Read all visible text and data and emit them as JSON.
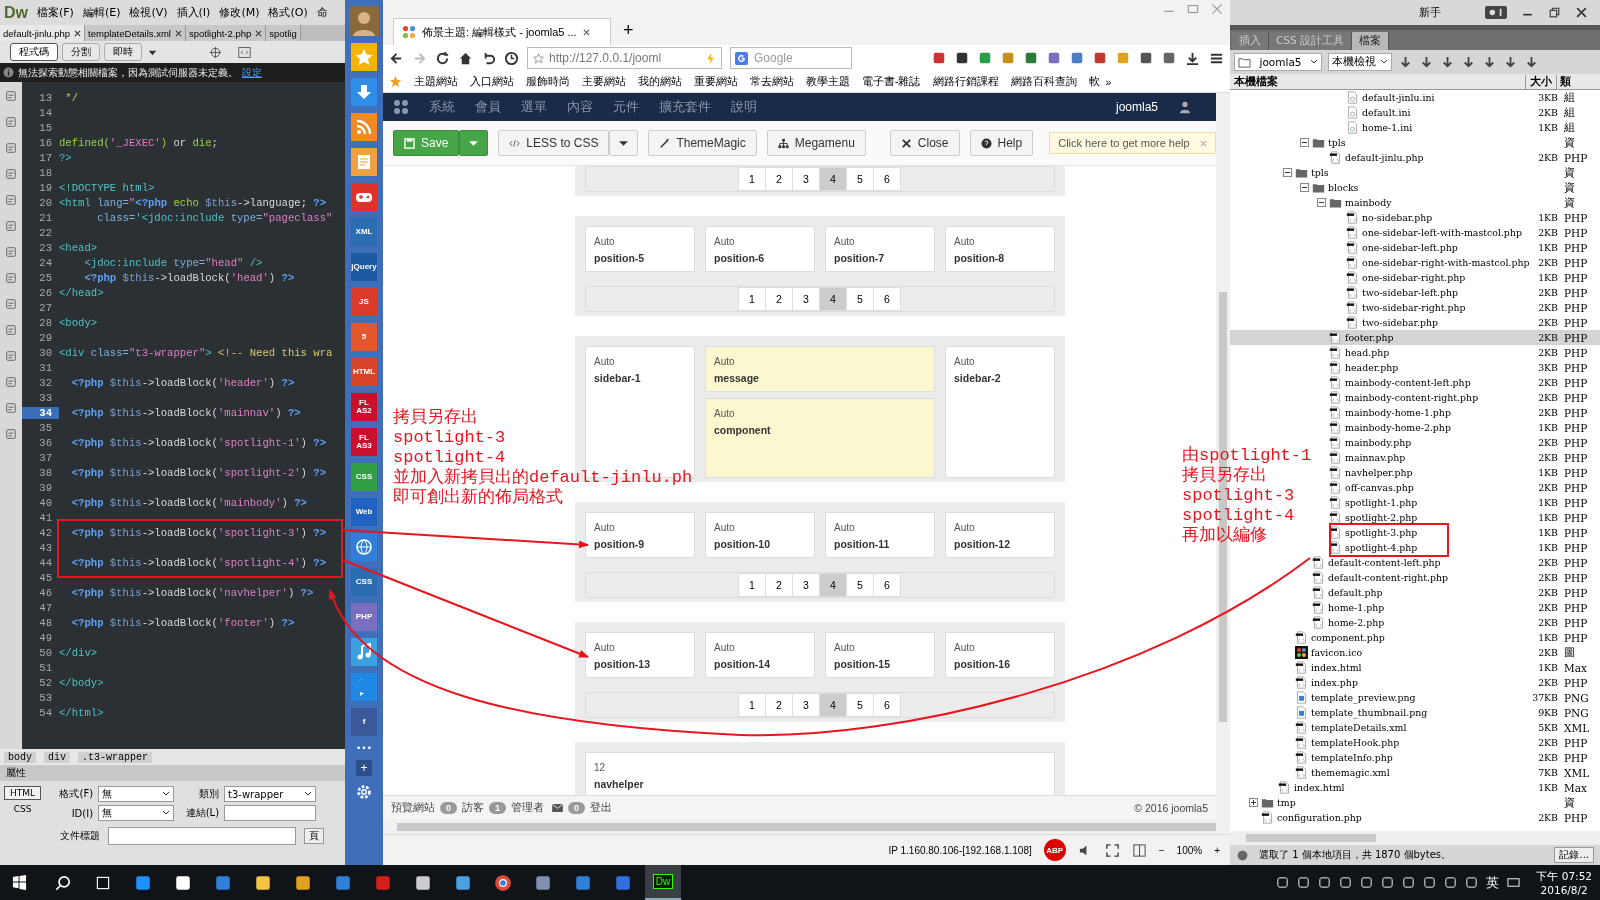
{
  "editor": {
    "logo": "Dw",
    "menu": [
      "檔案(F)",
      "編輯(E)",
      "檢視(V)",
      "插入(I)",
      "修改(M)",
      "格式(O)",
      "命"
    ],
    "doc_tabs": [
      {
        "label": "default-jinlu.php",
        "selected": true,
        "closable": true
      },
      {
        "label": "templateDetails.xml",
        "selected": false,
        "closable": true
      },
      {
        "label": "spotlight-2.php",
        "selected": false,
        "closable": true
      },
      {
        "label": "spotlig",
        "selected": false,
        "closable": false
      }
    ],
    "view_buttons": [
      {
        "label": "程式碼",
        "selected": true
      },
      {
        "label": "分割",
        "selected": false
      },
      {
        "label": "即時",
        "selected": false
      }
    ],
    "info": {
      "message": "無法探索動態相關檔案，因為測試伺服器未定義。",
      "link": "設定"
    },
    "lines": [
      {
        "n": "13",
        "selected": false,
        "code": [
          {
            "text": " */",
            "kind": "comment"
          }
        ]
      },
      {
        "n": "14",
        "selected": false
      },
      {
        "n": "15",
        "selected": false
      },
      {
        "n": "16",
        "selected": false,
        "code": [
          {
            "text": "defined(",
            "kind": "func"
          },
          {
            "text": "'_JEXEC'",
            "kind": "string"
          },
          {
            "text": ") ",
            "kind": "func"
          },
          {
            "text": "or ",
            "kind": "plain"
          },
          {
            "text": "die",
            "kind": "func"
          },
          {
            "text": ";",
            "kind": "plain"
          }
        ]
      },
      {
        "n": "17",
        "selected": false,
        "code": [
          {
            "text": "?>",
            "kind": "tag"
          }
        ]
      },
      {
        "n": "18",
        "selected": false
      },
      {
        "n": "19",
        "selected": false,
        "code": [
          {
            "text": "<!DOCTYPE html>",
            "kind": "tag"
          }
        ]
      },
      {
        "n": "20",
        "selected": false,
        "code": [
          {
            "text": "<html ",
            "kind": "tag"
          },
          {
            "text": "lang=",
            "kind": "attr"
          },
          {
            "text": "\"",
            "kind": "string"
          },
          {
            "text": "<?php ",
            "kind": "php"
          },
          {
            "text": "echo ",
            "kind": "func"
          },
          {
            "text": "$this",
            "kind": "var"
          },
          {
            "text": "->language; ",
            "kind": "plain"
          },
          {
            "text": "?>",
            "kind": "php"
          }
        ]
      },
      {
        "n": "21",
        "selected": false,
        "code": [
          {
            "text": "      class=",
            "kind": "attr"
          },
          {
            "text": "'<jdoc:include ",
            "kind": "tag"
          },
          {
            "text": "type=",
            "kind": "attr"
          },
          {
            "text": "\"pageclass\"",
            "kind": "string"
          }
        ]
      },
      {
        "n": "22",
        "selected": false
      },
      {
        "n": "23",
        "selected": false,
        "code": [
          {
            "text": "<head>",
            "kind": "tag"
          }
        ]
      },
      {
        "n": "24",
        "selected": false,
        "code": [
          {
            "text": "    <jdoc:include ",
            "kind": "tag"
          },
          {
            "text": "type=",
            "kind": "attr"
          },
          {
            "text": "\"head\"",
            "kind": "string"
          },
          {
            "text": " />",
            "kind": "tag"
          }
        ]
      },
      {
        "n": "25",
        "selected": false,
        "code": [
          {
            "text": "    <?php ",
            "kind": "php"
          },
          {
            "text": "$this",
            "kind": "var"
          },
          {
            "text": "->loadBlock(",
            "kind": "plain"
          },
          {
            "text": "'head'",
            "kind": "string"
          },
          {
            "text": ") ",
            "kind": "plain"
          },
          {
            "text": "?>",
            "kind": "php"
          }
        ]
      },
      {
        "n": "26",
        "selected": false,
        "code": [
          {
            "text": "</head>",
            "kind": "tag"
          }
        ]
      },
      {
        "n": "27",
        "selected": false
      },
      {
        "n": "28",
        "selected": false,
        "code": [
          {
            "text": "<body>",
            "kind": "tag"
          }
        ]
      },
      {
        "n": "29",
        "selected": false
      },
      {
        "n": "30",
        "selected": false,
        "code": [
          {
            "text": "<div ",
            "kind": "tag"
          },
          {
            "text": "class=",
            "kind": "attr"
          },
          {
            "text": "\"t3-wrapper\"",
            "kind": "string"
          },
          {
            "text": "> ",
            "kind": "tag"
          },
          {
            "text": "<!-- Need this wra",
            "kind": "comment"
          }
        ]
      },
      {
        "n": "31",
        "selected": false
      },
      {
        "n": "32",
        "selected": false,
        "code": [
          {
            "text": "  <?php ",
            "kind": "php"
          },
          {
            "text": "$this",
            "kind": "var"
          },
          {
            "text": "->loadBlock(",
            "kind": "plain"
          },
          {
            "text": "'header'",
            "kind": "string"
          },
          {
            "text": ") ",
            "kind": "plain"
          },
          {
            "text": "?>",
            "kind": "php"
          }
        ]
      },
      {
        "n": "33",
        "selected": false
      },
      {
        "n": "34",
        "selected": true,
        "code": [
          {
            "text": "  <?php ",
            "kind": "php"
          },
          {
            "text": "$this",
            "kind": "var"
          },
          {
            "text": "->loadBlock(",
            "kind": "plain"
          },
          {
            "text": "'mainnav'",
            "kind": "string"
          },
          {
            "text": ") ",
            "kind": "plain"
          },
          {
            "text": "?>",
            "kind": "php"
          }
        ]
      },
      {
        "n": "35",
        "selected": false
      },
      {
        "n": "36",
        "selected": false,
        "code": [
          {
            "text": "  <?php ",
            "kind": "php"
          },
          {
            "text": "$this",
            "kind": "var"
          },
          {
            "text": "->loadBlock(",
            "kind": "plain"
          },
          {
            "text": "'spotlight-1'",
            "kind": "string"
          },
          {
            "text": ") ",
            "kind": "plain"
          },
          {
            "text": "?>",
            "kind": "php"
          }
        ]
      },
      {
        "n": "37",
        "selected": false
      },
      {
        "n": "38",
        "selected": false,
        "code": [
          {
            "text": "  <?php ",
            "kind": "php"
          },
          {
            "text": "$this",
            "kind": "var"
          },
          {
            "text": "->loadBlock(",
            "kind": "plain"
          },
          {
            "text": "'spotlight-2'",
            "kind": "string"
          },
          {
            "text": ") ",
            "kind": "plain"
          },
          {
            "text": "?>",
            "kind": "php"
          }
        ]
      },
      {
        "n": "39",
        "selected": false
      },
      {
        "n": "40",
        "selected": false,
        "code": [
          {
            "text": "  <?php ",
            "kind": "php"
          },
          {
            "text": "$this",
            "kind": "var"
          },
          {
            "text": "->loadBlock(",
            "kind": "plain"
          },
          {
            "text": "'mainbody'",
            "kind": "string"
          },
          {
            "text": ") ",
            "kind": "plain"
          },
          {
            "text": "?>",
            "kind": "php"
          }
        ]
      },
      {
        "n": "41",
        "selected": false
      },
      {
        "n": "42",
        "selected": false,
        "code": [
          {
            "text": "  <?php ",
            "kind": "php"
          },
          {
            "text": "$this",
            "kind": "var"
          },
          {
            "text": "->loadBlock(",
            "kind": "plain"
          },
          {
            "text": "'spotlight-3'",
            "kind": "string"
          },
          {
            "text": ") ",
            "kind": "plain"
          },
          {
            "text": "?>",
            "kind": "php"
          }
        ]
      },
      {
        "n": "43",
        "selected": false
      },
      {
        "n": "44",
        "selected": false,
        "code": [
          {
            "text": "  <?php ",
            "kind": "php"
          },
          {
            "text": "$this",
            "kind": "var"
          },
          {
            "text": "->loadBlock(",
            "kind": "plain"
          },
          {
            "text": "'spotlight-4'",
            "kind": "string"
          },
          {
            "text": ") ",
            "kind": "plain"
          },
          {
            "text": "?>",
            "kind": "php"
          }
        ]
      },
      {
        "n": "45",
        "selected": false
      },
      {
        "n": "46",
        "selected": false,
        "code": [
          {
            "text": "  <?php ",
            "kind": "php"
          },
          {
            "text": "$this",
            "kind": "var"
          },
          {
            "text": "->loadBlock(",
            "kind": "plain"
          },
          {
            "text": "'navhelper'",
            "kind": "string"
          },
          {
            "text": ") ",
            "kind": "plain"
          },
          {
            "text": "?>",
            "kind": "php"
          }
        ]
      },
      {
        "n": "47",
        "selected": false
      },
      {
        "n": "48",
        "selected": false,
        "code": [
          {
            "text": "  <?php ",
            "kind": "php"
          },
          {
            "text": "$this",
            "kind": "var"
          },
          {
            "text": "->loadBlock(",
            "kind": "plain"
          },
          {
            "text": "'footer'",
            "kind": "string"
          },
          {
            "text": ") ",
            "kind": "plain"
          },
          {
            "text": "?>",
            "kind": "php"
          }
        ]
      },
      {
        "n": "49",
        "selected": false
      },
      {
        "n": "50",
        "selected": false,
        "code": [
          {
            "text": "</div>",
            "kind": "tag"
          }
        ]
      },
      {
        "n": "51",
        "selected": false
      },
      {
        "n": "52",
        "selected": false,
        "code": [
          {
            "text": "</body>",
            "kind": "tag"
          }
        ]
      },
      {
        "n": "53",
        "selected": false
      },
      {
        "n": "54",
        "selected": false,
        "code": [
          {
            "text": "</html>",
            "kind": "tag"
          }
        ]
      }
    ],
    "tag_path": [
      "body",
      "div",
      ".t3-wrapper"
    ],
    "properties": {
      "title": "屬性",
      "modes": [
        {
          "label": "HTML",
          "selected": true
        },
        {
          "label": "CSS",
          "selected": false
        }
      ],
      "format_label": "格式(F)",
      "format_value": "無",
      "class_label": "類別",
      "class_value": "t3-wrapper",
      "id_label": "ID(I)",
      "id_value": "無",
      "link_label": "連結(L)",
      "doc_title_label": "文件標題",
      "page_button": "頁"
    }
  },
  "launcher": [
    {
      "kind": "star",
      "color": "#f7b500"
    },
    {
      "kind": "download",
      "color": "#2f8fe8"
    },
    {
      "kind": "rss",
      "color": "#f08a24"
    },
    {
      "kind": "note",
      "color": "#f0a040"
    },
    {
      "kind": "game",
      "color": "#e0302a"
    },
    {
      "kind": "tile",
      "color": "#2a6db0",
      "label": "XML"
    },
    {
      "kind": "tile",
      "color": "#1d5aa5",
      "label": "jQuery"
    },
    {
      "kind": "tile",
      "color": "#d93a2b",
      "label": "JS"
    },
    {
      "kind": "tile",
      "color": "#e4572e",
      "label": "5"
    },
    {
      "kind": "tile",
      "color": "#d8442a",
      "label": "HTML"
    },
    {
      "kind": "tile",
      "color": "#c8102e",
      "label": "FL AS2"
    },
    {
      "kind": "tile",
      "color": "#c8102e",
      "label": "FL AS3"
    },
    {
      "kind": "tile",
      "color": "#2f9e44",
      "label": "CSS"
    },
    {
      "kind": "tile",
      "color": "#1f63c0",
      "label": "Web"
    },
    {
      "kind": "globe",
      "color": "#2f7fd8"
    },
    {
      "kind": "tile",
      "color": "#2a6db0",
      "label": "CSS"
    },
    {
      "kind": "tile",
      "color": "#7a6fbf",
      "label": "PHP"
    },
    {
      "kind": "music",
      "color": "#3aa0e0"
    },
    {
      "kind": "messenger",
      "color": "#1e88e5"
    },
    {
      "kind": "tile",
      "color": "#3b5998",
      "label": "f"
    }
  ],
  "launcher_more": "•••",
  "launcher_add": "+",
  "browser": {
    "tab_title": "佈景主題: 編輯樣式 - joomla5 ...",
    "new_tab": "+",
    "url": "http://127.0.0.1/jooml",
    "search_placeholder": "Google",
    "bookmarks": [
      "主題網站",
      "入口網站",
      "服飾時尚",
      "主要網站",
      "我的網站",
      "重要網站",
      "常去網站",
      "教學主題",
      "電子書-雜誌",
      "網路行銷課程",
      "網路百科查詢",
      "軟"
    ],
    "bookmarks_more": "»",
    "cms_menu": [
      "系統",
      "會員",
      "選單",
      "內容",
      "元件",
      "擴充套件",
      "說明"
    ],
    "cms_user": "joomla5",
    "toolbar": [
      {
        "kind": "save",
        "label": "Save"
      },
      {
        "kind": "less",
        "label": "LESS to CSS"
      },
      {
        "kind": "wand",
        "label": "ThemeMagic"
      },
      {
        "kind": "tree",
        "label": "Megamenu"
      },
      {
        "kind": "close",
        "label": "Close"
      },
      {
        "kind": "help",
        "label": "Help"
      }
    ],
    "help_tip": "Click here to get more help",
    "layout": [
      {
        "kind": "pager",
        "pager": [
          {
            "label": "1",
            "selected": false
          },
          {
            "label": "2",
            "selected": false
          },
          {
            "label": "3",
            "selected": false
          },
          {
            "label": "4",
            "selected": true
          },
          {
            "label": "5",
            "selected": false
          },
          {
            "label": "6",
            "selected": false
          }
        ]
      },
      {
        "kind": "positions",
        "blocks": [
          {
            "label": "Auto",
            "name": "position-5",
            "highlight": false
          },
          {
            "label": "Auto",
            "name": "position-6",
            "highlight": false
          },
          {
            "label": "Auto",
            "name": "position-7",
            "highlight": false
          },
          {
            "label": "Auto",
            "name": "position-8",
            "highlight": false
          }
        ],
        "pager": [
          {
            "label": "1",
            "selected": false
          },
          {
            "label": "2",
            "selected": false
          },
          {
            "label": "3",
            "selected": false
          },
          {
            "label": "4",
            "selected": true
          },
          {
            "label": "5",
            "selected": false
          },
          {
            "label": "6",
            "selected": false
          }
        ]
      },
      {
        "kind": "mainbody",
        "blocks": [
          {
            "label": "Auto",
            "name": "sidebar-1",
            "highlight": false
          },
          {
            "label": "Auto",
            "name": "message",
            "highlight": true
          },
          {
            "label": "Auto",
            "name": "component",
            "highlight": true
          },
          {
            "label": "Auto",
            "name": "sidebar-2",
            "highlight": false
          }
        ]
      },
      {
        "kind": "positions",
        "blocks": [
          {
            "label": "Auto",
            "name": "position-9",
            "highlight": false
          },
          {
            "label": "Auto",
            "name": "position-10",
            "highlight": false
          },
          {
            "label": "Auto",
            "name": "position-11",
            "highlight": false
          },
          {
            "label": "Auto",
            "name": "position-12",
            "highlight": false
          }
        ],
        "pager": [
          {
            "label": "1",
            "selected": false
          },
          {
            "label": "2",
            "selected": false
          },
          {
            "label": "3",
            "selected": false
          },
          {
            "label": "4",
            "selected": true
          },
          {
            "label": "5",
            "selected": false
          },
          {
            "label": "6",
            "selected": false
          }
        ]
      },
      {
        "kind": "positions",
        "blocks": [
          {
            "label": "Auto",
            "name": "position-13",
            "highlight": false
          },
          {
            "label": "Auto",
            "name": "position-14",
            "highlight": false
          },
          {
            "label": "Auto",
            "name": "position-15",
            "highlight": false
          },
          {
            "label": "Auto",
            "name": "position-16",
            "highlight": false
          }
        ],
        "pager": [
          {
            "label": "1",
            "selected": false
          },
          {
            "label": "2",
            "selected": false
          },
          {
            "label": "3",
            "selected": false
          },
          {
            "label": "4",
            "selected": true
          },
          {
            "label": "5",
            "selected": false
          },
          {
            "label": "6",
            "selected": false
          }
        ]
      },
      {
        "kind": "single",
        "blocks": [
          {
            "label": "12",
            "name": "navhelper",
            "highlight": false
          }
        ]
      }
    ],
    "footer": {
      "preview": "預覽網站",
      "visitors_count": "0",
      "visitors": "訪客",
      "admins_count": "1",
      "admins": "管理者",
      "messages_count": "0",
      "logout": "登出",
      "copyright": "© 2016 joomla5"
    },
    "status": {
      "ip": "IP  1.160.80.106-[192.168.1.108]",
      "adblock": "ABP",
      "zoom": "100%",
      "zoom_out": "−",
      "zoom_in": "+"
    }
  },
  "files": {
    "workspace": "新手",
    "tabs": [
      {
        "label": "插入",
        "selected": false
      },
      {
        "label": "CSS 設計工具",
        "selected": false
      },
      {
        "label": "檔案",
        "selected": true
      }
    ],
    "site": "joomla5",
    "view": "本機檢視",
    "columns": [
      "本機檔案",
      "大小",
      "類"
    ],
    "tree": [
      {
        "children": [
          {
            "children": [
              {
                "children": [
                  {
                    "children": [
                      {
                        "children": [
                          {
                            "name": "default-jinlu.ini",
                            "size": "3KB",
                            "type": "組",
                            "kind": "ini",
                            "selected": false
                          },
                          {
                            "name": "default.ini",
                            "size": "2KB",
                            "type": "組",
                            "kind": "ini",
                            "selected": false
                          },
                          {
                            "name": "home-1.ini",
                            "size": "1KB",
                            "type": "組",
                            "kind": "ini",
                            "selected": false
                          }
                        ]
                      }
                    ]
                  },
                  {
                    "name": "tpls",
                    "type": "資",
                    "kind": "folder",
                    "expanded": true,
                    "selected": false,
                    "children": [
                      {
                        "name": "default-jinlu.php",
                        "size": "2KB",
                        "type": "PHP",
                        "kind": "php",
                        "selected": false
                      }
                    ]
                  }
                ]
              },
              {
                "name": "tpls",
                "type": "資",
                "kind": "folder",
                "expanded": true,
                "selected": false,
                "children": [
                  {
                    "name": "blocks",
                    "type": "資",
                    "kind": "folder",
                    "expanded": true,
                    "selected": false,
                    "children": [
                      {
                        "name": "mainbody",
                        "type": "資",
                        "kind": "folder",
                        "expanded": true,
                        "selected": false,
                        "children": [
                          {
                            "name": "no-sidebar.php",
                            "size": "1KB",
                            "type": "PHP",
                            "kind": "php",
                            "selected": false
                          },
                          {
                            "name": "one-sidebar-left-with-mastcol.php",
                            "size": "2KB",
                            "type": "PHP",
                            "kind": "php",
                            "selected": false
                          },
                          {
                            "name": "one-sidebar-left.php",
                            "size": "1KB",
                            "type": "PHP",
                            "kind": "php",
                            "selected": false
                          },
                          {
                            "name": "one-sidebar-right-with-mastcol.php",
                            "size": "2KB",
                            "type": "PHP",
                            "kind": "php",
                            "selected": false
                          },
                          {
                            "name": "one-sidebar-right.php",
                            "size": "1KB",
                            "type": "PHP",
                            "kind": "php",
                            "selected": false
                          },
                          {
                            "name": "two-sidebar-left.php",
                            "size": "2KB",
                            "type": "PHP",
                            "kind": "php",
                            "selected": false
                          },
                          {
                            "name": "two-sidebar-right.php",
                            "size": "2KB",
                            "type": "PHP",
                            "kind": "php",
                            "selected": false
                          },
                          {
                            "name": "two-sidebar.php",
                            "size": "2KB",
                            "type": "PHP",
                            "kind": "php",
                            "selected": false
                          }
                        ]
                      },
                      {
                        "name": "footer.php",
                        "size": "2KB",
                        "type": "PHP",
                        "kind": "php",
                        "selected": true
                      },
                      {
                        "name": "head.php",
                        "size": "2KB",
                        "type": "PHP",
                        "kind": "php",
                        "selected": false
                      },
                      {
                        "name": "header.php",
                        "size": "3KB",
                        "type": "PHP",
                        "kind": "php",
                        "selected": false
                      },
                      {
                        "name": "mainbody-content-left.php",
                        "size": "2KB",
                        "type": "PHP",
                        "kind": "php",
                        "selected": false
                      },
                      {
                        "name": "mainbody-content-right.php",
                        "size": "2KB",
                        "type": "PHP",
                        "kind": "php",
                        "selected": false
                      },
                      {
                        "name": "mainbody-home-1.php",
                        "size": "2KB",
                        "type": "PHP",
                        "kind": "php",
                        "selected": false
                      },
                      {
                        "name": "mainbody-home-2.php",
                        "size": "1KB",
                        "type": "PHP",
                        "kind": "php",
                        "selected": false
                      },
                      {
                        "name": "mainbody.php",
                        "size": "2KB",
                        "type": "PHP",
                        "kind": "php",
                        "selected": false
                      },
                      {
                        "name": "mainnav.php",
                        "size": "2KB",
                        "type": "PHP",
                        "kind": "php",
                        "selected": false
                      },
                      {
                        "name": "navhelper.php",
                        "size": "1KB",
                        "type": "PHP",
                        "kind": "php",
                        "selected": false
                      },
                      {
                        "name": "off-canvas.php",
                        "size": "2KB",
                        "type": "PHP",
                        "kind": "php",
                        "selected": false
                      },
                      {
                        "name": "spotlight-1.php",
                        "size": "1KB",
                        "type": "PHP",
                        "kind": "php",
                        "selected": false
                      },
                      {
                        "name": "spotlight-2.php",
                        "size": "1KB",
                        "type": "PHP",
                        "kind": "php",
                        "selected": false
                      },
                      {
                        "name": "spotlight-3.php",
                        "size": "1KB",
                        "type": "PHP",
                        "kind": "php",
                        "selected": false
                      },
                      {
                        "name": "spotlight-4.php",
                        "size": "1KB",
                        "type": "PHP",
                        "kind": "php",
                        "selected": false
                      }
                    ]
                  },
                  {
                    "name": "default-content-left.php",
                    "size": "2KB",
                    "type": "PHP",
                    "kind": "php",
                    "selected": false
                  },
                  {
                    "name": "default-content-right.php",
                    "size": "2KB",
                    "type": "PHP",
                    "kind": "php",
                    "selected": false
                  },
                  {
                    "name": "default.php",
                    "size": "2KB",
                    "type": "PHP",
                    "kind": "php",
                    "selected": false
                  },
                  {
                    "name": "home-1.php",
                    "size": "2KB",
                    "type": "PHP",
                    "kind": "php",
                    "selected": false
                  },
                  {
                    "name": "home-2.php",
                    "size": "2KB",
                    "type": "PHP",
                    "kind": "php",
                    "selected": false
                  }
                ]
              },
              {
                "name": "component.php",
                "size": "1KB",
                "type": "PHP",
                "kind": "php",
                "selected": false
              },
              {
                "name": "favicon.ico",
                "size": "2KB",
                "type": "圖",
                "kind": "logo",
                "selected": false
              },
              {
                "name": "index.html",
                "size": "1KB",
                "type": "Max",
                "kind": "php",
                "selected": false
              },
              {
                "name": "index.php",
                "size": "2KB",
                "type": "PHP",
                "kind": "php",
                "selected": false
              },
              {
                "name": "template_preview.png",
                "size": "37KB",
                "type": "PNG",
                "kind": "image",
                "selected": false
              },
              {
                "name": "template_thumbnail.png",
                "size": "9KB",
                "type": "PNG",
                "kind": "image",
                "selected": false
              },
              {
                "name": "templateDetails.xml",
                "size": "5KB",
                "type": "XML",
                "kind": "php",
                "selected": false
              },
              {
                "name": "templateHook.php",
                "size": "2KB",
                "type": "PHP",
                "kind": "php",
                "selected": false
              },
              {
                "name": "templateInfo.php",
                "size": "2KB",
                "type": "PHP",
                "kind": "php",
                "selected": false
              },
              {
                "name": "thememagic.xml",
                "size": "7KB",
                "type": "XML",
                "kind": "php",
                "selected": false
              }
            ]
          },
          {
            "name": "index.html",
            "size": "1KB",
            "type": "Max",
            "kind": "php",
            "selected": false
          }
        ]
      },
      {
        "name": "tmp",
        "type": "資",
        "kind": "folder",
        "expanded": false,
        "selected": false
      },
      {
        "name": "configuration.php",
        "size": "2KB",
        "type": "PHP",
        "kind": "php",
        "selected": false
      }
    ],
    "status": "選取了 1 個本地項目，共 1870 個bytes。",
    "log_button": "記錄..."
  },
  "taskbar": {
    "apps": [
      {
        "kind": "search",
        "color": "#ffffff"
      },
      {
        "kind": "taskview",
        "color": "#ffffff"
      },
      {
        "kind": "app",
        "color": "#1e90ff"
      },
      {
        "kind": "app",
        "color": "#ffffff"
      },
      {
        "kind": "app",
        "color": "#2f7fd8"
      },
      {
        "kind": "app",
        "color": "#f5c542"
      },
      {
        "kind": "app",
        "color": "#e0a020"
      },
      {
        "kind": "app",
        "color": "#2f7fd8"
      },
      {
        "kind": "app",
        "color": "#d4201a"
      },
      {
        "kind": "app",
        "color": "#cccccc"
      },
      {
        "kind": "app",
        "color": "#4aa0e0"
      },
      {
        "kind": "chrome",
        "color": "#e04a3a"
      },
      {
        "kind": "app",
        "color": "#8090b0"
      },
      {
        "kind": "app",
        "color": "#2f7fd8"
      },
      {
        "kind": "app",
        "color": "#3070e0"
      },
      {
        "kind": "dw",
        "color": "#35fa00",
        "label": "Dw"
      }
    ],
    "ime": "英",
    "time": "下午 07:52",
    "date": "2016/8/2"
  },
  "annotations": [
    {
      "lines": [
        "拷貝另存出",
        "spotlight-3",
        "spotlight-4",
        "並加入新拷貝出的default-jinlu.ph",
        "即可創出新的佈局格式"
      ]
    },
    {
      "lines": [
        "由spotlight-1",
        "拷貝另存出",
        "spotlight-3",
        "spotlight-4",
        "再加以編修"
      ]
    }
  ]
}
